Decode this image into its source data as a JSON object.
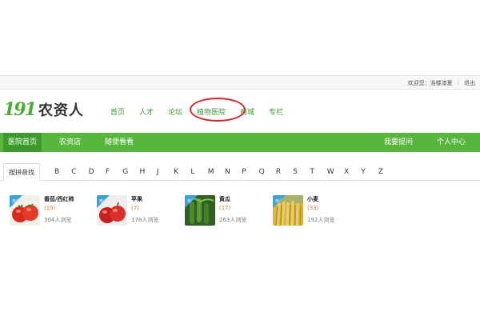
{
  "topbar": {
    "welcome": "欢迎您：浩楼漆夏",
    "separator": "|",
    "logout": "退出"
  },
  "header": {
    "logo_mark": "191",
    "logo_text": "农资人",
    "nav": [
      "首页",
      "人才",
      "论坛",
      "植物医院",
      "商城",
      "专栏"
    ]
  },
  "greenbar": {
    "items": [
      "医院首页",
      "农资店",
      "随便看看"
    ],
    "right": [
      "我要提问",
      "个人中心"
    ]
  },
  "letters": {
    "label": "按拼音找",
    "items": [
      "B",
      "C",
      "D",
      "F",
      "G",
      "H",
      "J",
      "K",
      "L",
      "M",
      "N",
      "P",
      "Q",
      "R",
      "S",
      "T",
      "W",
      "X",
      "Y",
      "Z"
    ]
  },
  "crops": [
    {
      "name": "番茄/西红柿",
      "count": "(19)",
      "views": "304人浏览",
      "tag": "热门",
      "icon": "tomato-image"
    },
    {
      "name": "苹果",
      "count": "(7)",
      "views": "178人浏览",
      "tag": "热门",
      "icon": "apple-image"
    },
    {
      "name": "黄瓜",
      "count": "(17)",
      "views": "263人浏览",
      "tag": "热门",
      "icon": "cucumber-image"
    },
    {
      "name": "小麦",
      "count": "(33)",
      "views": "192人浏览",
      "tag": "热门",
      "icon": "wheat-image"
    }
  ],
  "colors": {
    "brand_green": "#58b63f",
    "active_green": "#3f9a2e",
    "highlight_circle": "#d9262c",
    "count_orange": "#e8782a"
  }
}
